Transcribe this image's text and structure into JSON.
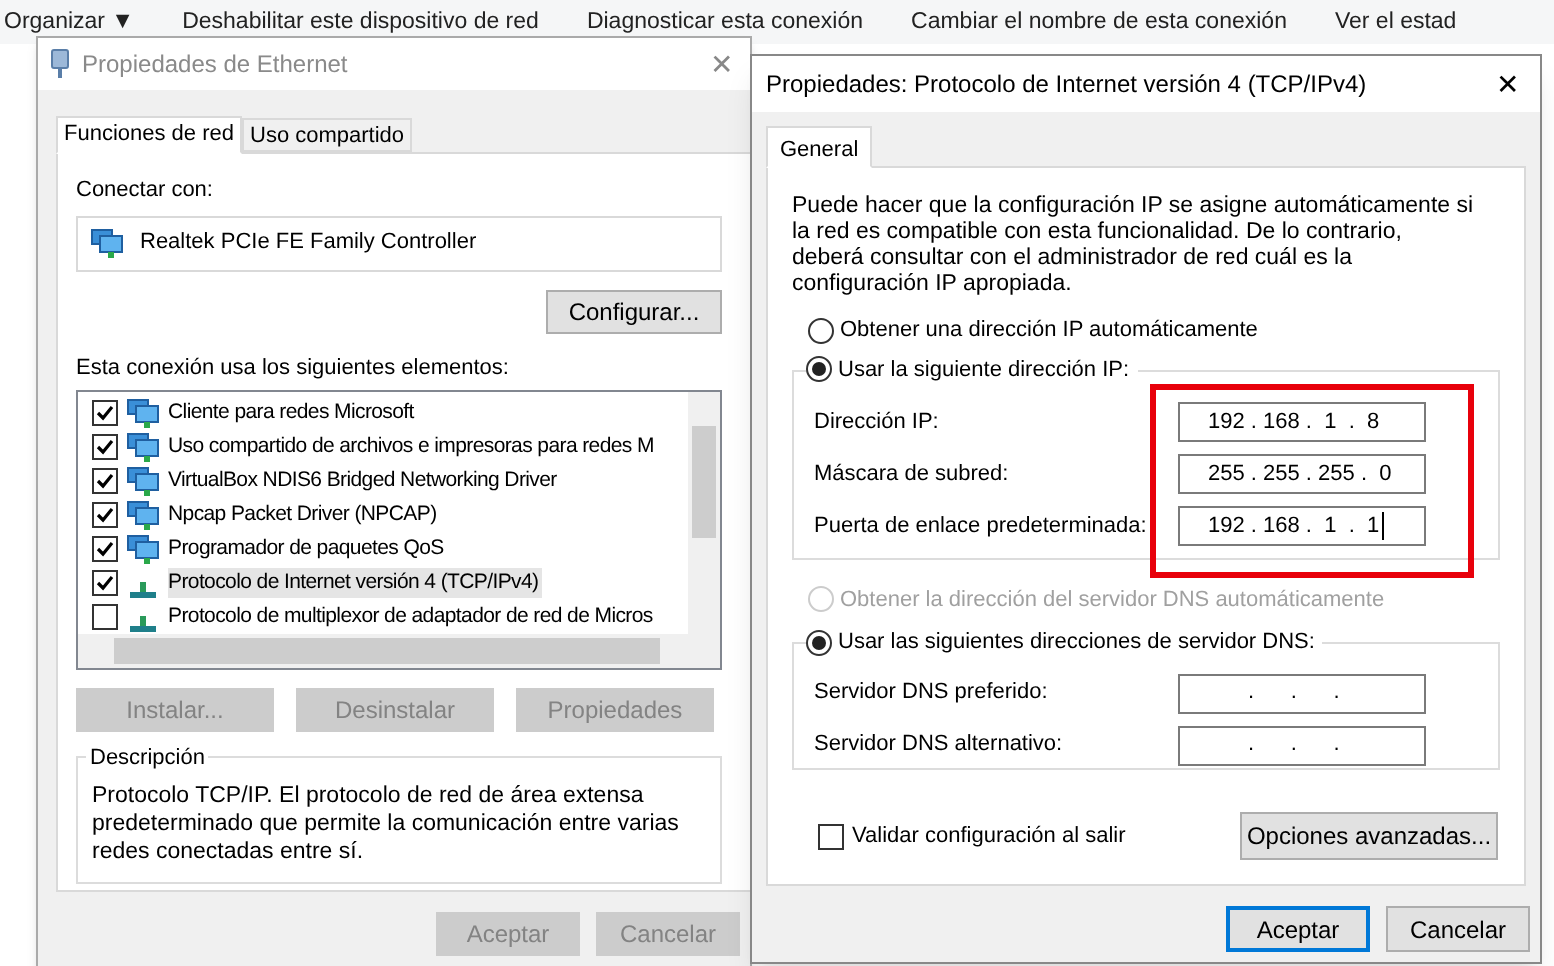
{
  "toolbar": {
    "items": [
      "Organizar ▼",
      "Deshabilitar este dispositivo de red",
      "Diagnosticar esta conexión",
      "Cambiar el nombre de esta conexión",
      "Ver el estad"
    ]
  },
  "ethernet_dialog": {
    "title": "Propiedades de Ethernet",
    "close": "✕",
    "tabs": [
      {
        "label": "Funciones de red",
        "selected": true
      },
      {
        "label": "Uso compartido",
        "selected": false
      }
    ],
    "connect_label": "Conectar con:",
    "adapter": "Realtek PCIe FE Family Controller",
    "configure_button": "Configurar...",
    "items_label": "Esta conexión usa los siguientes elementos:",
    "items": [
      {
        "label": "Cliente para redes Microsoft",
        "checked": true,
        "selected": false,
        "kind": "client"
      },
      {
        "label": "Uso compartido de archivos e impresoras para redes M",
        "checked": true,
        "selected": false,
        "kind": "service"
      },
      {
        "label": "VirtualBox NDIS6 Bridged Networking Driver",
        "checked": true,
        "selected": false,
        "kind": "service"
      },
      {
        "label": "Npcap Packet Driver (NPCAP)",
        "checked": true,
        "selected": false,
        "kind": "service"
      },
      {
        "label": "Programador de paquetes QoS",
        "checked": true,
        "selected": false,
        "kind": "service"
      },
      {
        "label": "Protocolo de Internet versión 4 (TCP/IPv4)",
        "checked": true,
        "selected": true,
        "kind": "protocol"
      },
      {
        "label": "Protocolo de multiplexor de adaptador de red de Micros",
        "checked": false,
        "selected": false,
        "kind": "protocol"
      }
    ],
    "buttons": [
      {
        "label": "Instalar...",
        "disabled": true
      },
      {
        "label": "Desinstalar",
        "disabled": true
      },
      {
        "label": "Propiedades",
        "disabled": true
      }
    ],
    "description": {
      "title": "Descripción",
      "text": "Protocolo TCP/IP. El protocolo de red de área extensa predeterminado que permite la comunicación entre varias redes conectadas entre sí."
    },
    "footer_buttons": [
      {
        "label": "Aceptar",
        "disabled": true
      },
      {
        "label": "Cancelar",
        "disabled": true
      }
    ]
  },
  "ipv4_dialog": {
    "title": "Propiedades: Protocolo de Internet versión 4 (TCP/IPv4)",
    "close": "✕",
    "tabs": [
      {
        "label": "General",
        "selected": true
      }
    ],
    "intro": "Puede hacer que la configuración IP se asigne automáticamente si la red es compatible con esta funcionalidad. De lo contrario, deberá consultar con el administrador de red cuál es la configuración IP apropiada.",
    "ip_options": [
      {
        "label": "Obtener una dirección IP automáticamente",
        "selected": false,
        "disabled": false
      },
      {
        "label": "Usar la siguiente dirección IP:",
        "selected": true,
        "disabled": false
      }
    ],
    "ip_fields_highlighted": true,
    "ip_fields": [
      {
        "label": "Dirección IP:",
        "value": "192 . 168 .  1  .  8",
        "focused": false
      },
      {
        "label": "Máscara de subred:",
        "value": "255 . 255 . 255 .  0",
        "focused": false
      },
      {
        "label": "Puerta de enlace predeterminada:",
        "value": "192 . 168 .  1  .  1",
        "focused": true
      }
    ],
    "dns_options": [
      {
        "label": "Obtener la dirección del servidor DNS automáticamente",
        "selected": false,
        "disabled": true
      },
      {
        "label": "Usar las siguientes direcciones de servidor DNS:",
        "selected": true,
        "disabled": false
      }
    ],
    "dns_fields": [
      {
        "label": "Servidor DNS preferido:",
        "value": ".      .      .",
        "focused": false
      },
      {
        "label": "Servidor DNS alternativo:",
        "value": ".      .      .",
        "focused": false
      }
    ],
    "validate": {
      "label": "Validar configuración al salir",
      "checked": false
    },
    "advanced_button": "Opciones avanzadas...",
    "footer_buttons": [
      {
        "label": "Aceptar",
        "focused": true
      },
      {
        "label": "Cancelar",
        "focused": false
      }
    ]
  }
}
